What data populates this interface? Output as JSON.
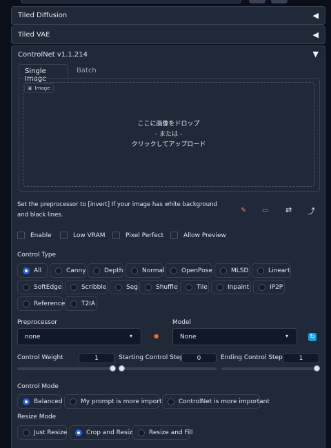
{
  "accordions": {
    "tiled_diffusion": "Tiled Diffusion",
    "tiled_vae": "Tiled VAE",
    "controlnet": "ControlNet v1.1.214"
  },
  "tabs": [
    "Single Image",
    "Batch"
  ],
  "image_box": {
    "label": "Image",
    "drop_line1": "ここに画像をドロップ",
    "drop_line2": "- または -",
    "drop_line3": "クリックしてアップロード"
  },
  "hint": "Set the preprocessor to [invert] If your image has white background and black lines.",
  "toggles": {
    "enable": "Enable",
    "low_vram": "Low VRAM",
    "pixel_perfect": "Pixel Perfect",
    "allow_preview": "Allow Preview"
  },
  "control_type": {
    "label": "Control Type",
    "options": [
      "All",
      "Canny",
      "Depth",
      "Normal",
      "OpenPose",
      "MLSD",
      "Lineart",
      "SoftEdge",
      "Scribble",
      "Seg",
      "Shuffle",
      "Tile",
      "Inpaint",
      "IP2P",
      "Reference",
      "T2IA"
    ],
    "selected": "All"
  },
  "preprocessor": {
    "label": "Preprocessor",
    "value": "none"
  },
  "model": {
    "label": "Model",
    "value": "None"
  },
  "sliders": {
    "weight": {
      "label": "Control Weight",
      "value": "1",
      "level": 1.0
    },
    "start": {
      "label": "Starting Control Step",
      "value": "0",
      "level": 0.0
    },
    "end": {
      "label": "Ending Control Step",
      "value": "1",
      "level": 1.0
    }
  },
  "control_mode": {
    "label": "Control Mode",
    "options": [
      "Balanced",
      "My prompt is more important",
      "ControlNet is more important"
    ],
    "selected": "Balanced"
  },
  "resize_mode": {
    "label": "Resize Mode",
    "options": [
      "Just Resize",
      "Crop and Resize",
      "Resize and Fill"
    ],
    "selected": "Crop and Resize"
  },
  "colors": {
    "accent": "#2563eb",
    "bg": "#0b0f19",
    "panel": "#1f2937"
  }
}
